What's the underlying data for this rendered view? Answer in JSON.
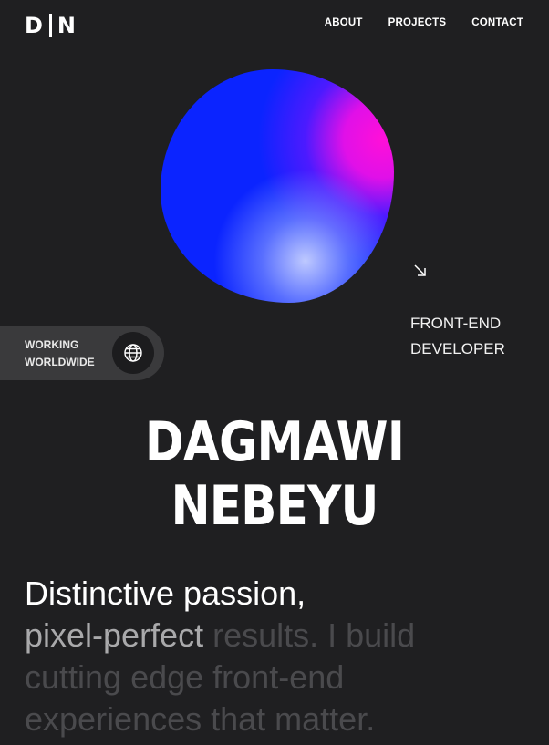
{
  "logo": {
    "left": "D",
    "right": "N"
  },
  "nav": {
    "about": "ABOUT",
    "projects": "PROJECTS",
    "contact": "CONTACT"
  },
  "role": {
    "line1": "FRONT-END",
    "line2": "DEVELOPER"
  },
  "badge": {
    "line1": "WORKING",
    "line2": "WORLDWIDE"
  },
  "name": "DAGMAWI NEBEYU",
  "intro": {
    "line1": "Distinctive passion,",
    "highlight": "pixel-perfect",
    "rest1": " results. I build",
    "line3": "cutting edge front-end",
    "line4": "experiences that matter."
  },
  "colors": {
    "background": "#1f1f21",
    "blob_blue": "#0b24ff",
    "blob_magenta": "#ff10d8",
    "pill": "#3a3a3c"
  },
  "icons": {
    "arrow": "arrow-down-right-icon",
    "globe": "globe-icon"
  }
}
